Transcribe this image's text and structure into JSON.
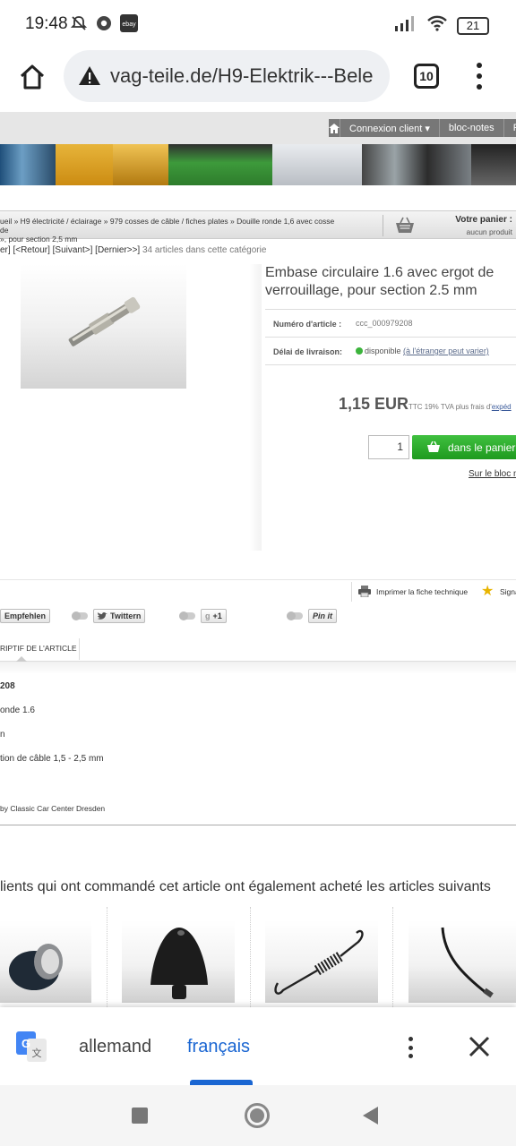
{
  "status_bar": {
    "time": "19:48",
    "battery": "21"
  },
  "browser": {
    "url": "vag-teile.de/H9-Elektrik---Bele",
    "tab_count": "10"
  },
  "site": {
    "topnav": {
      "items": [
        "Connexion client ▾",
        "bloc-notes",
        "P"
      ]
    },
    "breadcrumb": {
      "line1": "ueil » H9 électricité / éclairage » 979 cosses de câble / fiches plates » Douille ronde 1,6 avec cosse de",
      "line2": "», pour section 2,5 mm"
    },
    "cart": {
      "title": "Votre panier :",
      "subtitle": "aucun produit"
    },
    "pager": {
      "links": "er] [<Retour] [Suivant>] [Dernier>>]",
      "count": " 34 articles dans cette catégorie"
    },
    "product": {
      "title": "Embase circulaire 1.6 avec ergot de verrouillage, pour section 2.5 mm",
      "article_label": "Numéro d'article :",
      "article_value": "ccc_000979208",
      "delivery_label": "Délai de livraison:",
      "delivery_status": "disponible",
      "delivery_link": "(à l'étranger peut varier)",
      "price": "1,15 EUR",
      "price_note_prefix": "TTC 19% TVA plus frais d'",
      "price_note_link": "expéd",
      "quantity": "1",
      "add_to_cart": "dans le panier",
      "notebook_link": "Sur le bloc n"
    },
    "actions": {
      "print": "Imprimer la fiche technique",
      "signal": "Signa"
    },
    "social": {
      "empfehlen": "Empfehlen",
      "twitter": "Twittern",
      "gplus": "+1",
      "pinit": "Pin it"
    },
    "tab_label": "RIPTIF DE L'ARTICLE",
    "description": [
      "208",
      "onde 1.6",
      "n",
      "tion de câble 1,5 - 2,5 mm"
    ],
    "copyright": "by Classic Car Center Dresden",
    "also_bought": "lients qui ont commandé cet article ont également acheté les articles suivants"
  },
  "translate_bar": {
    "lang_source": "allemand",
    "lang_target": "français"
  },
  "colors": {
    "accent_green": "#2aa52a",
    "translate_blue": "#1a66d2"
  }
}
